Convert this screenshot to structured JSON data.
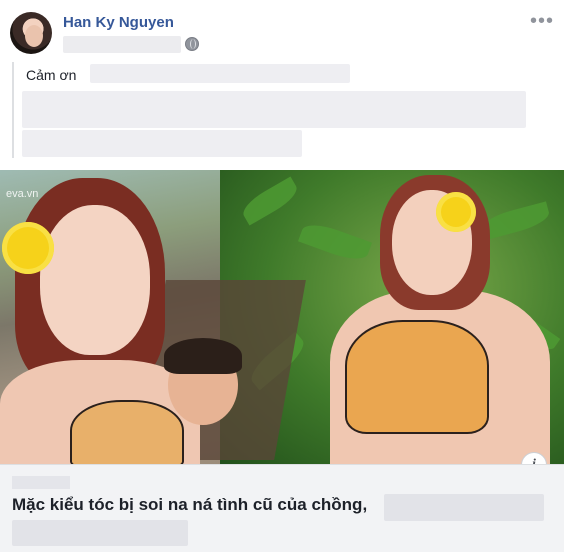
{
  "post": {
    "author": "Han Ky Nguyen",
    "more_glyph": "•••",
    "caption_visible": "Cảm ơn",
    "privacy_icon": "globe-icon"
  },
  "image": {
    "watermark": "eva.vn"
  },
  "link_preview": {
    "title_visible": "Mặc kiểu tóc bị soi na ná tình cũ của chồng,",
    "info_glyph": "i"
  },
  "colors": {
    "author_link": "#365899",
    "text": "#1d2129",
    "panel_bg": "#f2f3f5",
    "secondary": "#90949c"
  }
}
